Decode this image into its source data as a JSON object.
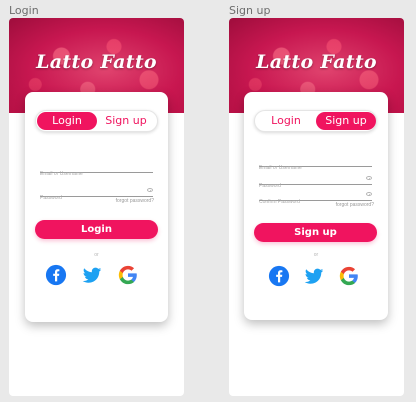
{
  "frames": {
    "login": {
      "label": "Login",
      "brand": "Latto Fatto",
      "tabs": {
        "login": "Login",
        "signup": "Sign up",
        "active": "login"
      },
      "fields": {
        "username_placeholder": "Email or Username",
        "password_placeholder": "Password"
      },
      "forgot": "forgot password?",
      "cta": "Login",
      "or": "or"
    },
    "signup": {
      "label": "Sign up",
      "brand": "Latto Fatto",
      "tabs": {
        "login": "Login",
        "signup": "Sign up",
        "active": "signup"
      },
      "fields": {
        "username_placeholder": "Email or Username",
        "password_placeholder": "Password",
        "confirm_placeholder": "Confirm Password"
      },
      "forgot": "forgot password?",
      "cta": "Sign up",
      "or": "or"
    }
  },
  "social_icons": [
    "facebook-icon",
    "twitter-icon",
    "google-icon"
  ],
  "colors": {
    "accent": "#f0145f",
    "facebook": "#1877f2",
    "twitter": "#1da1f2",
    "canvas": "#e9e9e9"
  }
}
